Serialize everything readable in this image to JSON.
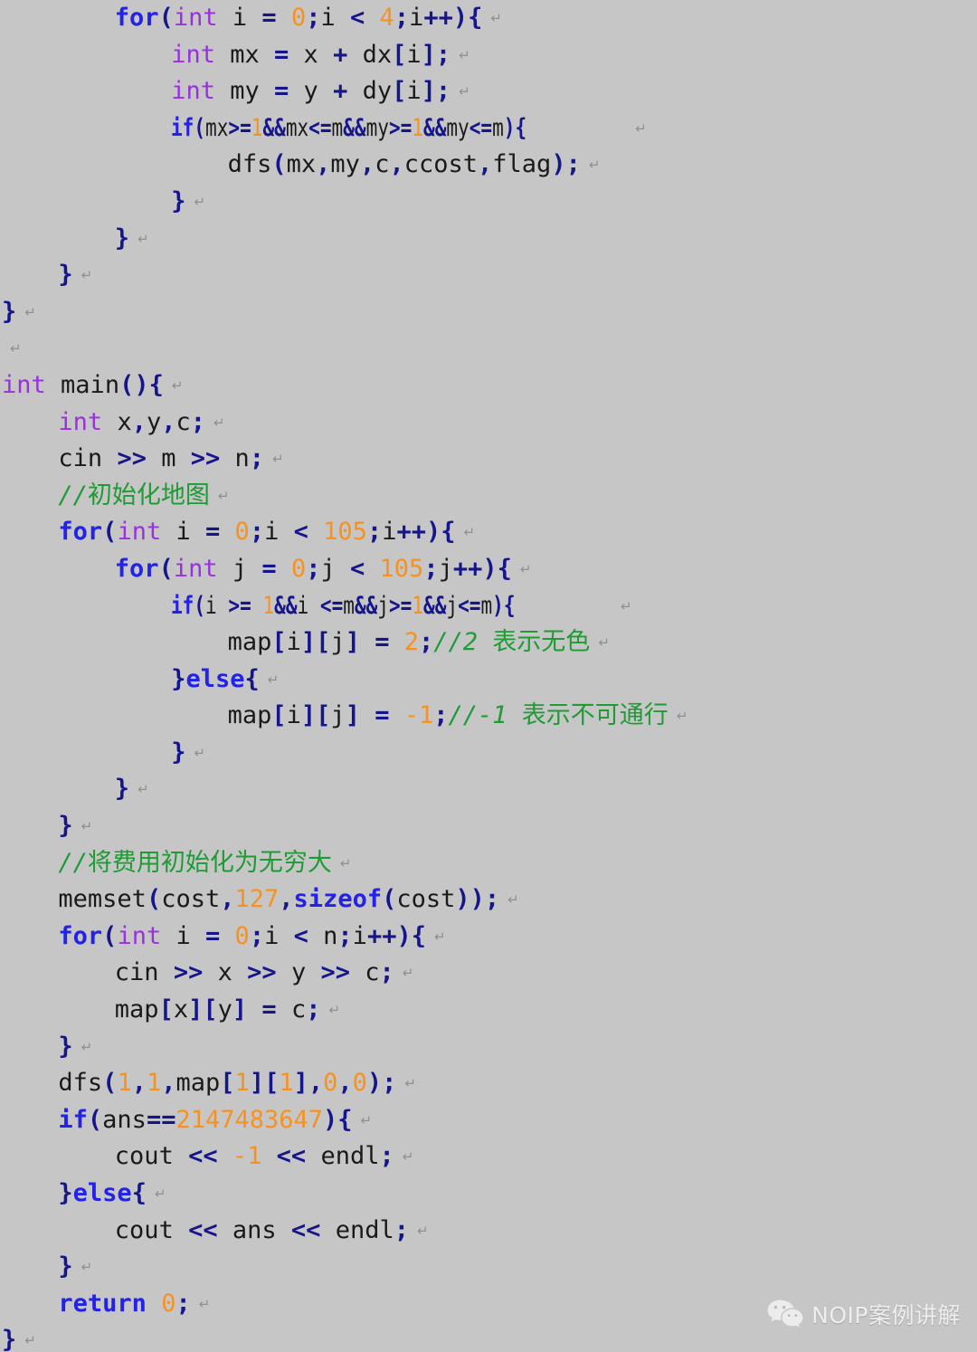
{
  "meta": {
    "background_color": "#c6c6c6",
    "language": "C++"
  },
  "colors": {
    "keyword": "#2222e8",
    "type": "#9a30e0",
    "number": "#f79221",
    "punctuation": "#16168c",
    "plain_text": "#1a1a1a",
    "comment": "#1f9b34",
    "return_mark": "#8f8f8f",
    "watermark_text": "#f2f2f2"
  },
  "code": {
    "return_mark": "↵",
    "lines": [
      {
        "id": "l01",
        "indent": 8,
        "text": "for(int i = 0;i < 4;i++){"
      },
      {
        "id": "l02",
        "indent": 12,
        "text": "int mx = x + dx[i];"
      },
      {
        "id": "l03",
        "indent": 12,
        "text": "int my = y + dy[i];"
      },
      {
        "id": "l04",
        "indent": 12,
        "text": "if(mx>=1&&mx<=m&&my>=1&&my<=m){"
      },
      {
        "id": "l05",
        "indent": 16,
        "text": "dfs(mx,my,c,ccost,flag);"
      },
      {
        "id": "l06",
        "indent": 12,
        "text": "}"
      },
      {
        "id": "l07",
        "indent": 8,
        "text": "}"
      },
      {
        "id": "l08",
        "indent": 4,
        "text": "}"
      },
      {
        "id": "l09",
        "indent": 0,
        "text": "}"
      },
      {
        "id": "l10",
        "indent": 0,
        "text": ""
      },
      {
        "id": "l11",
        "indent": 0,
        "text": "int main(){"
      },
      {
        "id": "l12",
        "indent": 4,
        "text": "int x,y,c;"
      },
      {
        "id": "l13",
        "indent": 4,
        "text": "cin >> m >> n;"
      },
      {
        "id": "l14",
        "indent": 4,
        "text": "//初始化地图"
      },
      {
        "id": "l15",
        "indent": 4,
        "text": "for(int i = 0;i < 105;i++){"
      },
      {
        "id": "l16",
        "indent": 8,
        "text": "for(int j = 0;j < 105;j++){"
      },
      {
        "id": "l17",
        "indent": 12,
        "text": "if(i >= 1&&i <=m&&j>=1&&j<=m){"
      },
      {
        "id": "l18",
        "indent": 16,
        "text": "map[i][j] = 2;//2 表示无色"
      },
      {
        "id": "l19",
        "indent": 12,
        "text": "}else{"
      },
      {
        "id": "l20",
        "indent": 16,
        "text": "map[i][j] = -1;//-1 表示不可通行"
      },
      {
        "id": "l21",
        "indent": 12,
        "text": "}"
      },
      {
        "id": "l22",
        "indent": 8,
        "text": "}"
      },
      {
        "id": "l23",
        "indent": 4,
        "text": "}"
      },
      {
        "id": "l24",
        "indent": 4,
        "text": "//将费用初始化为无穷大"
      },
      {
        "id": "l25",
        "indent": 4,
        "text": "memset(cost,127,sizeof(cost));"
      },
      {
        "id": "l26",
        "indent": 4,
        "text": "for(int i = 0;i < n;i++){"
      },
      {
        "id": "l27",
        "indent": 8,
        "text": "cin >> x >> y >> c;"
      },
      {
        "id": "l28",
        "indent": 8,
        "text": "map[x][y] = c;"
      },
      {
        "id": "l29",
        "indent": 4,
        "text": "}"
      },
      {
        "id": "l30",
        "indent": 4,
        "text": "dfs(1,1,map[1][1],0,0);"
      },
      {
        "id": "l31",
        "indent": 4,
        "text": "if(ans==2147483647){"
      },
      {
        "id": "l32",
        "indent": 8,
        "text": "cout << -1 << endl;"
      },
      {
        "id": "l33",
        "indent": 4,
        "text": "}else{"
      },
      {
        "id": "l34",
        "indent": 8,
        "text": "cout << ans << endl;"
      },
      {
        "id": "l35",
        "indent": 4,
        "text": "}"
      },
      {
        "id": "l36",
        "indent": 4,
        "text": "return 0;"
      },
      {
        "id": "l37",
        "indent": 0,
        "text": "}"
      }
    ],
    "comments": [
      "//初始化地图",
      "//2 表示无色",
      "//-1 表示不可通行",
      "//将费用初始化为无穷大"
    ],
    "keywords": [
      "for",
      "if",
      "else",
      "return",
      "sizeof"
    ],
    "types": [
      "int"
    ],
    "numbers": [
      "0",
      "4",
      "1",
      "105",
      "2",
      "-1",
      "127",
      "n",
      "2147483647"
    ]
  },
  "watermark": {
    "icon": "wechat-icon",
    "label": "NOIP案例讲解"
  }
}
